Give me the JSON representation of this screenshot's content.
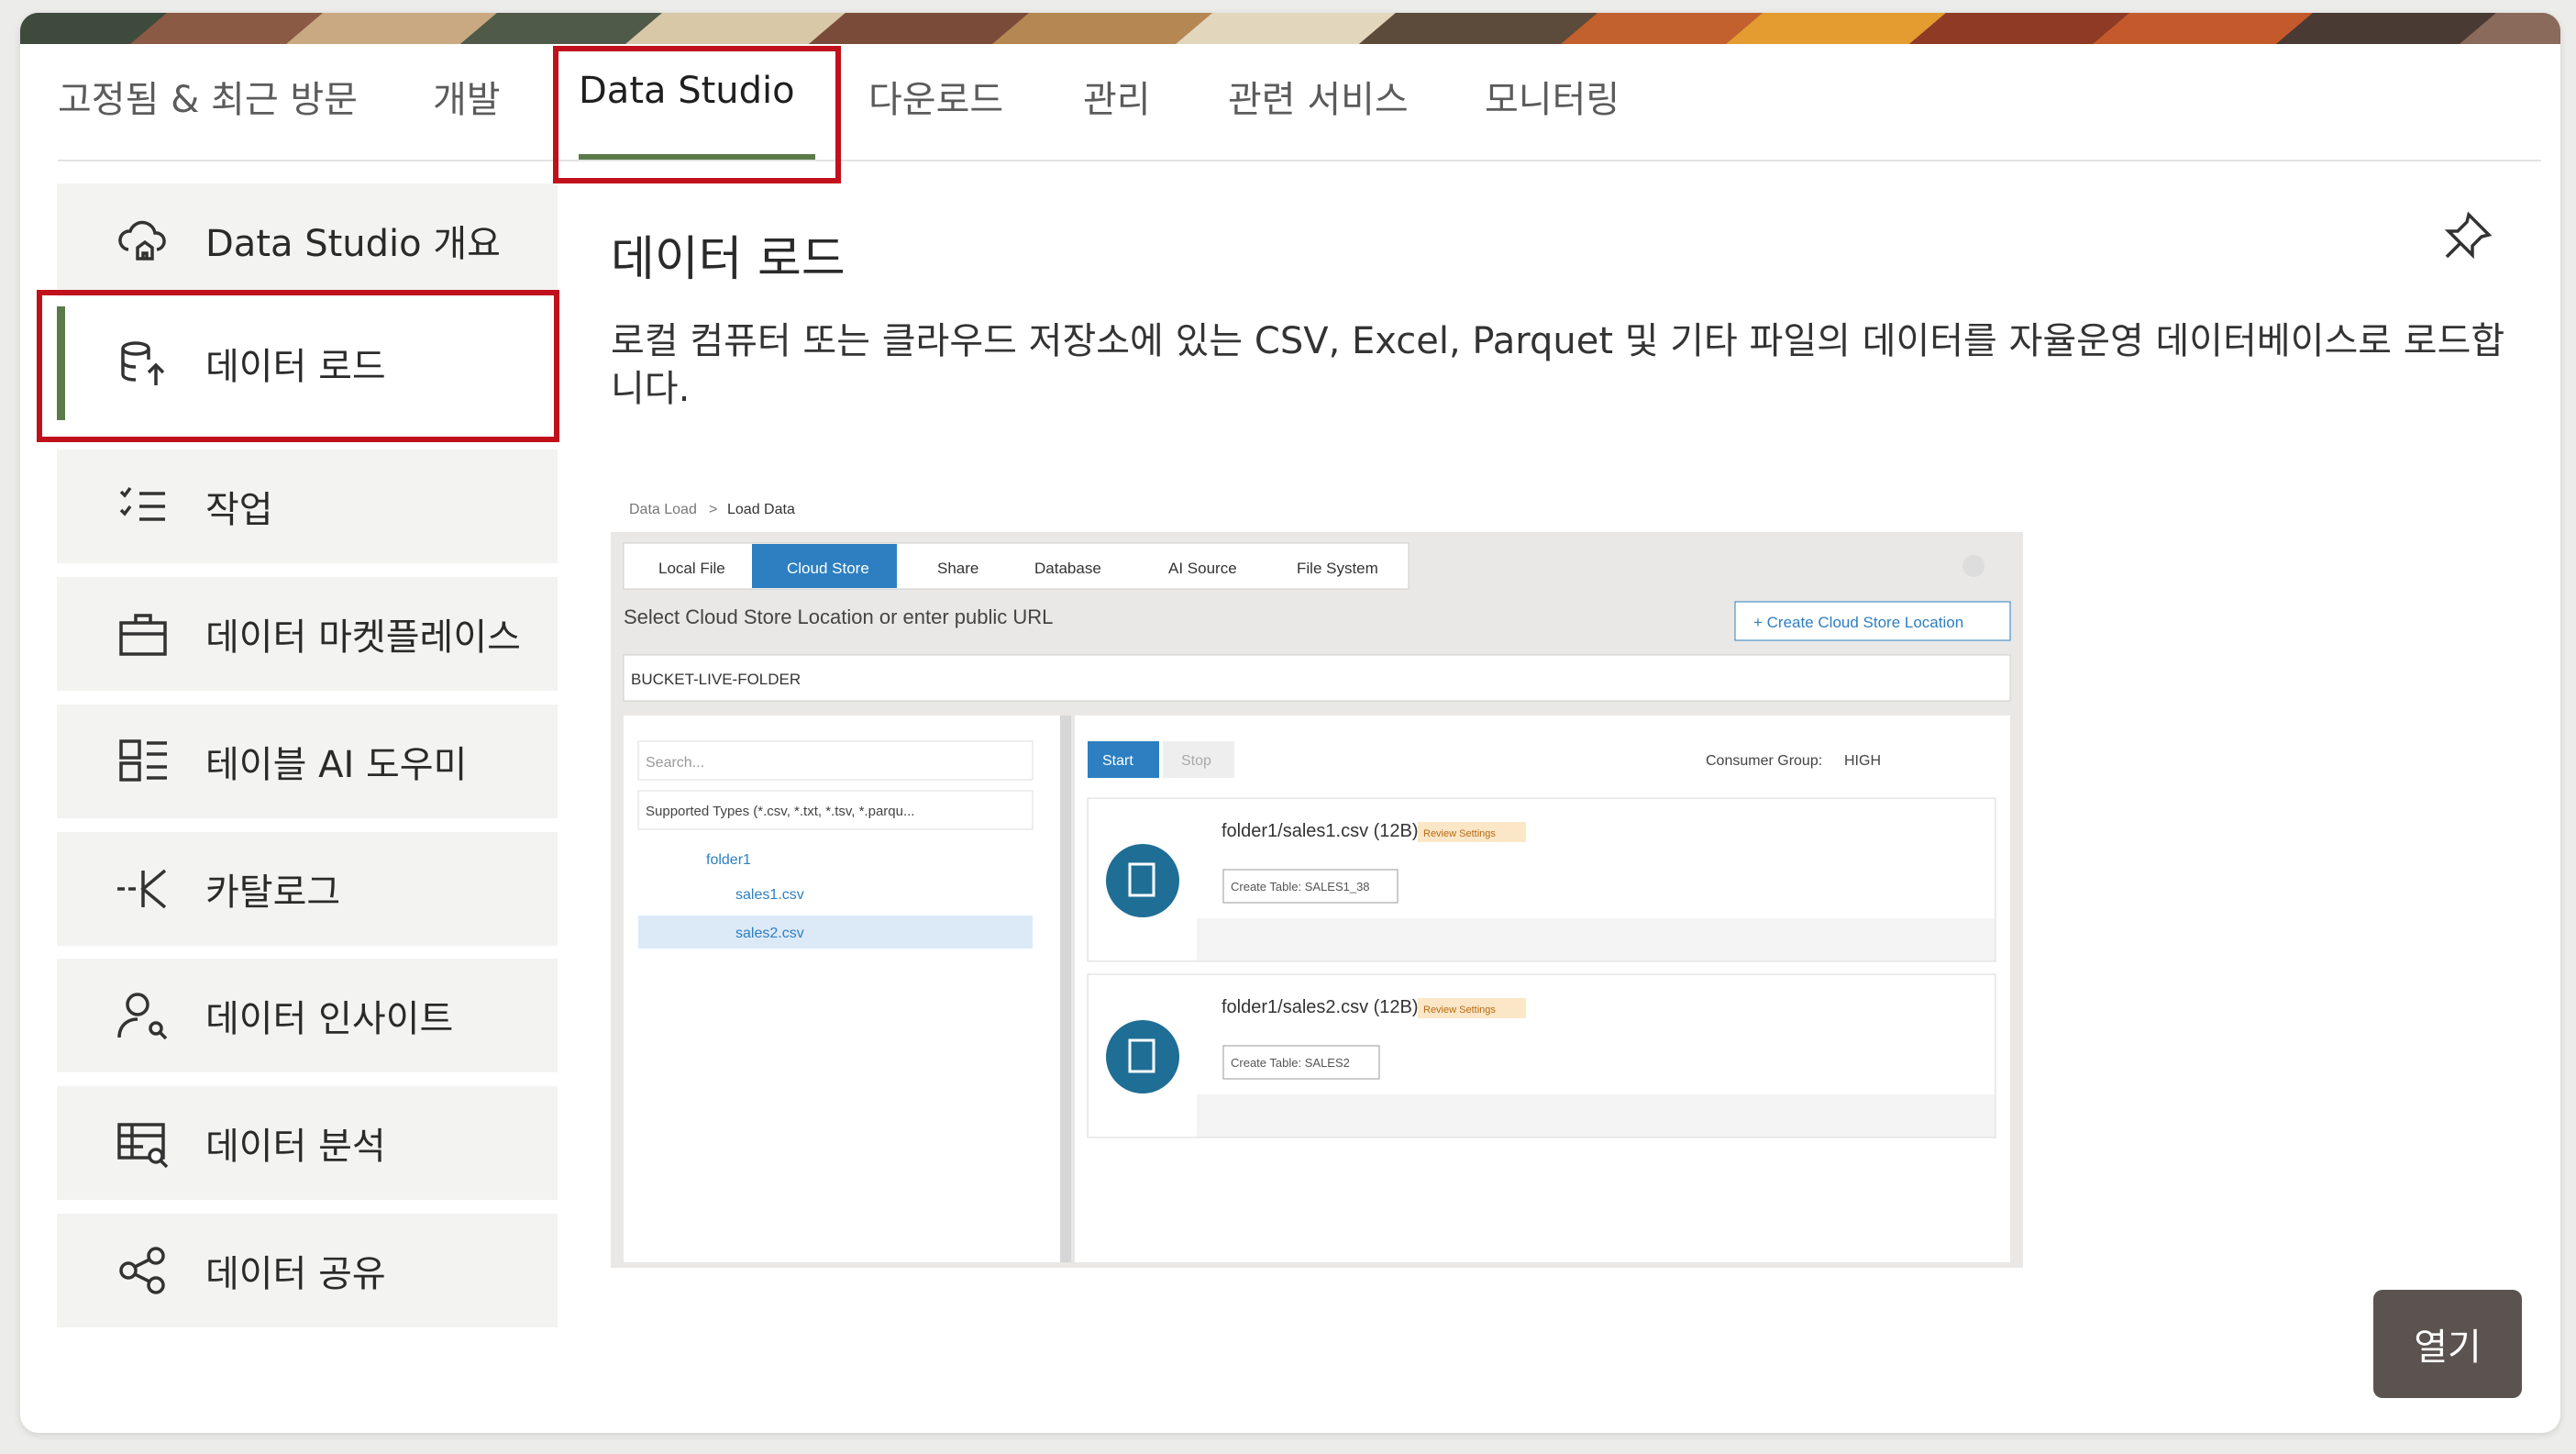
{
  "tabs": [
    {
      "label": "고정됨 & 최근 방문"
    },
    {
      "label": "개발"
    },
    {
      "label": "Data Studio",
      "active": true
    },
    {
      "label": "다운로드"
    },
    {
      "label": "관리"
    },
    {
      "label": "관련 서비스"
    },
    {
      "label": "모니터링"
    }
  ],
  "sidebar": {
    "items": [
      {
        "label": "Data Studio 개요",
        "icon": "cloud-home-icon"
      },
      {
        "label": "데이터 로드",
        "icon": "database-upload-icon",
        "active": true
      },
      {
        "label": "작업",
        "icon": "task-list-icon"
      },
      {
        "label": "데이터 마켓플레이스",
        "icon": "briefcase-icon"
      },
      {
        "label": "테이블 AI 도우미",
        "icon": "table-assistant-icon"
      },
      {
        "label": "카탈로그",
        "icon": "catalog-icon"
      },
      {
        "label": "데이터 인사이트",
        "icon": "person-search-icon"
      },
      {
        "label": "데이터 분석",
        "icon": "table-search-icon"
      },
      {
        "label": "데이터 공유",
        "icon": "share-icon"
      }
    ]
  },
  "content": {
    "title": "데이터 로드",
    "description": "로컬 컴퓨터 또는 클라우드 저장소에 있는 CSV, Excel, Parquet 및 기타 파일의 데이터를 자율운영 데이터베이스로 로드합니다.",
    "open_button": "열기"
  },
  "preview": {
    "breadcrumb": {
      "root": "Data Load",
      "sep": ">",
      "current": "Load Data"
    },
    "source_tabs": [
      "Local File",
      "Cloud Store",
      "Share",
      "Database",
      "AI Source",
      "File System"
    ],
    "active_source_tab": "Cloud Store",
    "prompt": "Select Cloud Store Location or enter public URL",
    "create_button": "+ Create Cloud Store Location",
    "bucket_value": "BUCKET-LIVE-FOLDER",
    "search_placeholder": "Search...",
    "supported_types": "Supported Types (*.csv, *.txt, *.tsv, *.parqu...",
    "tree": {
      "folder": "folder1",
      "files": [
        "sales1.csv",
        "sales2.csv"
      ]
    },
    "start_button": "Start",
    "stop_button": "Stop",
    "consumer_group_label": "Consumer Group:",
    "consumer_group_value": "HIGH",
    "cards": [
      {
        "file": "folder1/sales1.csv (12B)",
        "badge": "Review Settings",
        "action": "Create Table: SALES1_38"
      },
      {
        "file": "folder1/sales2.csv (12B)",
        "badge": "Review Settings",
        "action": "Create Table: SALES2"
      }
    ]
  },
  "colors": {
    "accent_green": "#5b7a4a",
    "highlight_red": "#c0101c",
    "button_dark": "#5a5350",
    "oracle_blue": "#1f6e96",
    "preview_blue": "#2d7fc1"
  }
}
